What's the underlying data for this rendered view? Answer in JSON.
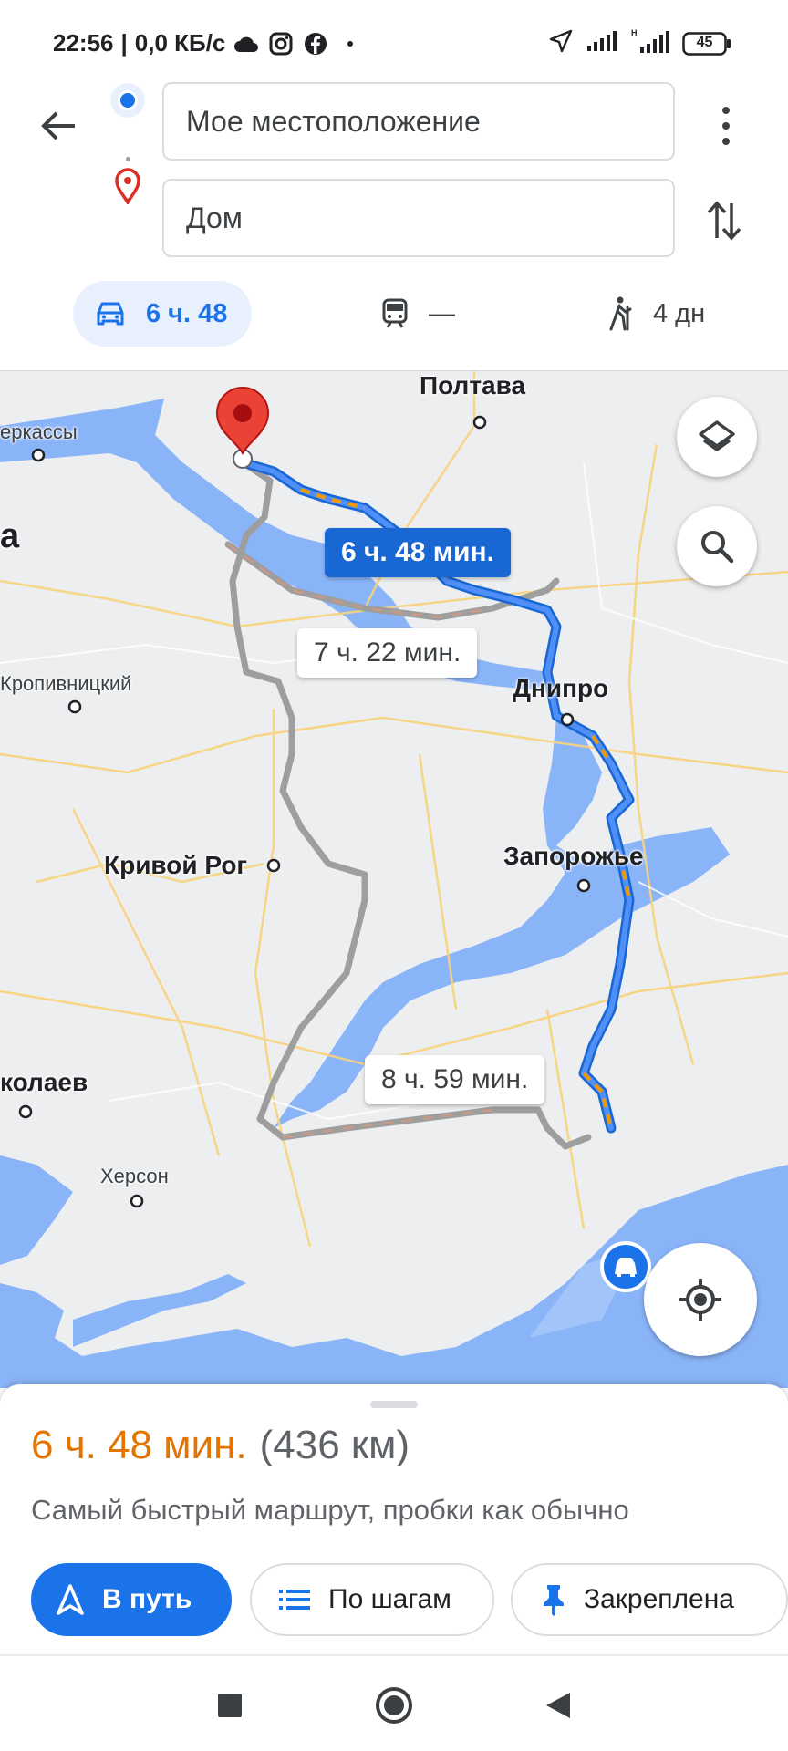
{
  "status": {
    "time": "22:56",
    "speed": "0,0 КБ/с",
    "battery": "45",
    "icons": [
      "cloud-icon",
      "instagram-icon",
      "facebook-icon",
      "dot-icon",
      "location-arrow-icon",
      "signal-icon",
      "signal-h-icon",
      "battery-icon"
    ]
  },
  "route": {
    "origin": "Мое местоположение",
    "destination": "Дом"
  },
  "modes": {
    "car": "6 ч. 48",
    "transit": "—",
    "walk": "4 дн"
  },
  "map": {
    "cities": {
      "poltava": "Полтава",
      "cherkassy": "еркассы",
      "kropyvnytskyi": "Кропивницкий",
      "dnipro": "Днипро",
      "zaporozhye": "Запорожье",
      "kryvyi_rih": "Кривой Рог",
      "mykolaiv": "колаев",
      "kherson": "Херсон",
      "edge_a": "а"
    },
    "eta": {
      "primary": "6 ч. 48 мин.",
      "alt1": "7 ч. 22 мин.",
      "alt2": "8 ч. 59 мин."
    }
  },
  "sheet": {
    "duration": "6 ч. 48 мин.",
    "distance": "(436 км)",
    "description": "Самый быстрый маршрут, пробки как обычно",
    "start": "В путь",
    "steps": "По шагам",
    "pinned": "Закреплена"
  },
  "colors": {
    "accent": "#1a73e8",
    "eta_primary": "#1967d2",
    "duration": "#e37400",
    "water": "#8ab4f8",
    "alt_route": "#9e9e9e"
  }
}
